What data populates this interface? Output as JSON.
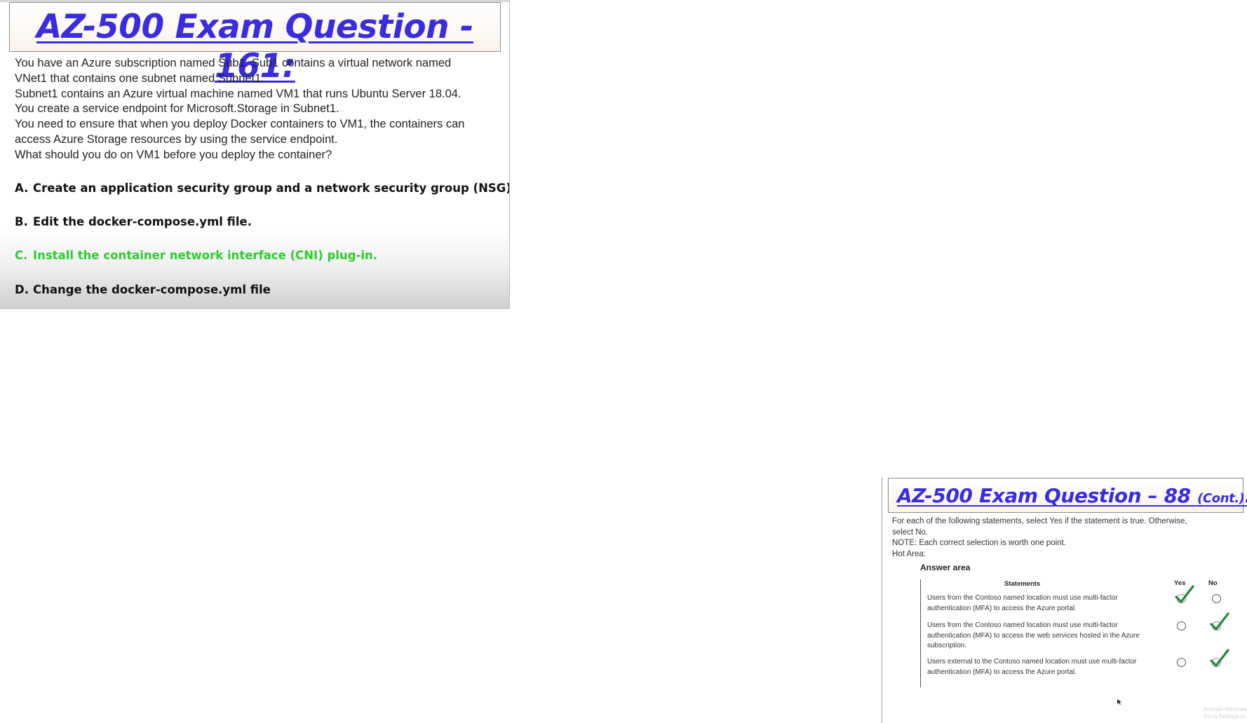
{
  "question1": {
    "title": "AZ-500 Exam Question - 161:",
    "lines": [
      "You have an Azure subscription named Sub1. Sub1 contains a virtual network named",
      "VNet1 that contains one subnet named Subnet1.",
      "Subnet1 contains an Azure virtual machine named VM1 that runs Ubuntu Server 18.04.",
      "You create a service endpoint for Microsoft.Storage in Subnet1.",
      "You need to ensure that when you deploy Docker containers to VM1, the containers can",
      "access Azure Storage resources by using the service endpoint.",
      "What should you do on VM1 before you deploy the container?"
    ],
    "options": [
      {
        "letter": "A.",
        "text": "Create an application security group and a network security group (NSG).",
        "correct": false
      },
      {
        "letter": "B.",
        "text": "Edit the docker-compose.yml file.",
        "correct": false
      },
      {
        "letter": "C.",
        "text": "Install the container network interface (CNI) plug-in.",
        "correct": true
      },
      {
        "letter": "D.",
        "text": "Change the docker-compose.yml file",
        "correct": false
      }
    ],
    "colors": {
      "title": "#3a2ce0",
      "correct": "#2ecc2e"
    }
  },
  "question2": {
    "title_main": "AZ-500 Exam Question – 88",
    "title_cont": "(Cont.)",
    "title_colon": ":",
    "instructions": [
      "For each of the following statements, select Yes if the statement is true. Otherwise,",
      "select No.",
      "NOTE: Each correct selection is worth one point.",
      "Hot Area:"
    ],
    "answer_area_label": "Answer area",
    "table_headers": {
      "statements": "Statements",
      "yes": "Yes",
      "no": "No"
    },
    "statements": [
      {
        "lines": [
          "Users from the Contoso named location must use multi-factor",
          "authentication (MFA) to access the Azure portal."
        ],
        "answer": "Yes"
      },
      {
        "lines": [
          "Users from the Contoso named location must use multi-factor",
          "authentication (MFA) to access the web services hosted in the Azure",
          "subscription."
        ],
        "answer": "No"
      },
      {
        "lines": [
          "Users external to the Contoso named location must use multi-factor",
          "authentication (MFA) to access the Azure portal."
        ],
        "answer": "No"
      }
    ],
    "watermark": [
      "Activate Windows",
      "Go to Settings to activate Windows."
    ],
    "icons": {
      "selected": "green-check-icon",
      "unselected": "radio-circle-icon"
    }
  }
}
